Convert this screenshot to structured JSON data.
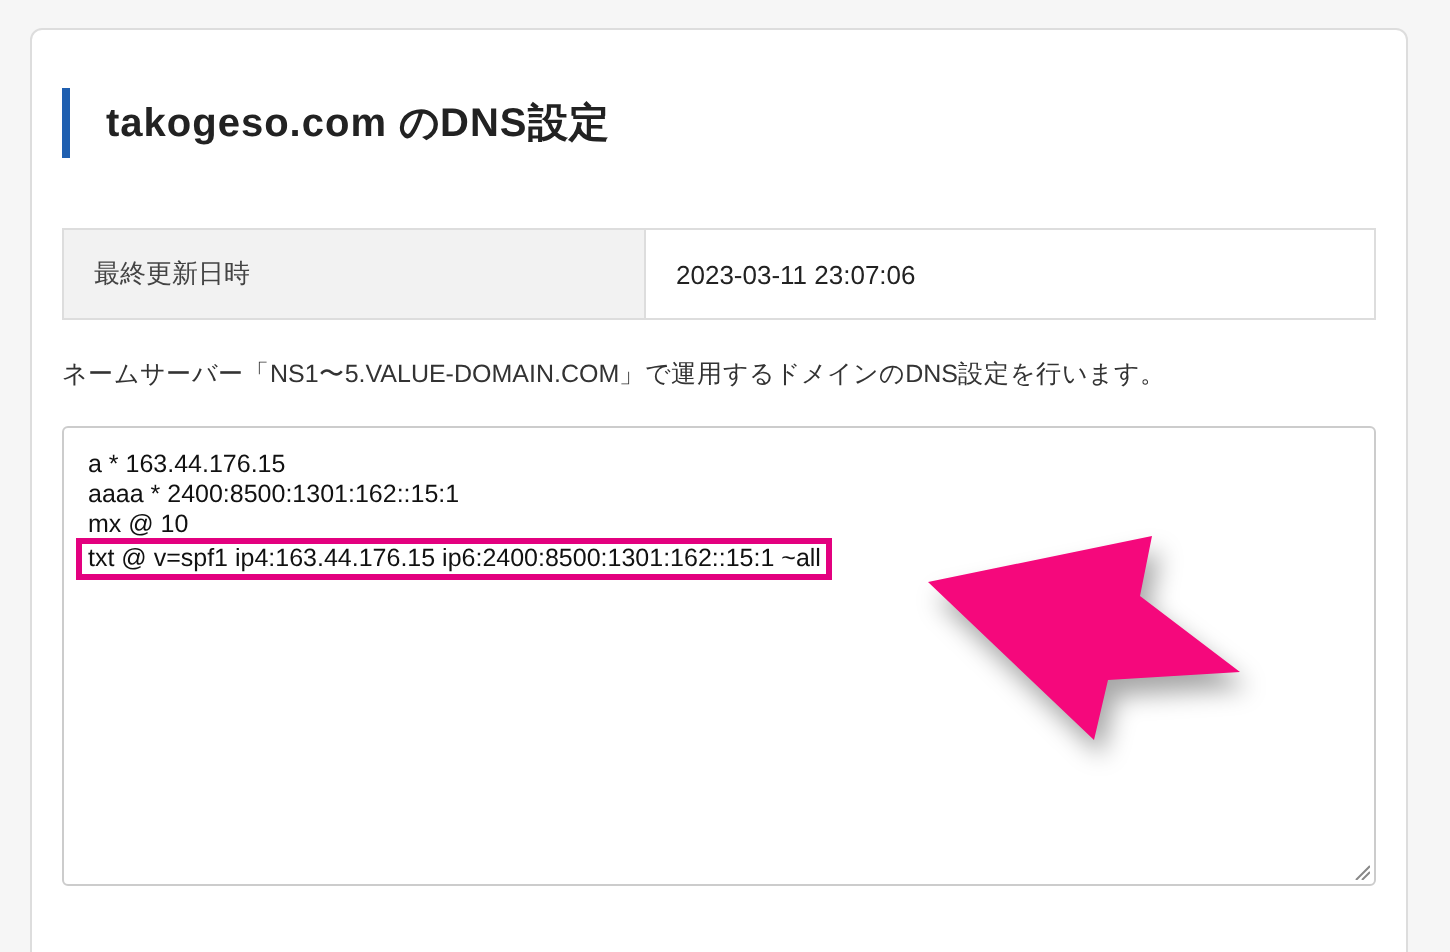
{
  "heading": "takogeso.com のDNS設定",
  "info_table": {
    "rows": [
      {
        "label": "最終更新日時",
        "value": "2023-03-11 23:07:06"
      }
    ]
  },
  "description": "ネームサーバー「NS1〜5.VALUE-DOMAIN.COM」で運用するドメインのDNS設定を行います。",
  "records_editor": {
    "lines": [
      {
        "text": "a * 163.44.176.15",
        "highlighted": false
      },
      {
        "text": "aaaa * 2400:8500:1301:162::15:1",
        "highlighted": false
      },
      {
        "text": "mx @ 10",
        "highlighted": false
      },
      {
        "text": "txt @ v=spf1 ip4:163.44.176.15 ip6:2400:8500:1301:162::15:1 ~all",
        "highlighted": true
      }
    ]
  }
}
